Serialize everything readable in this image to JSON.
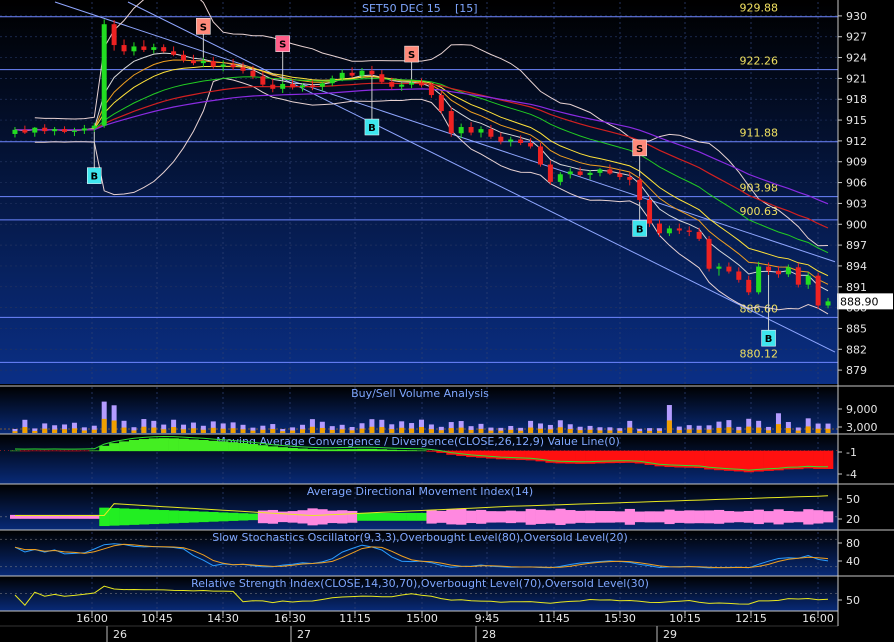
{
  "chart_data": {
    "type": "candlestick",
    "title": "SET50 DEC 15",
    "interval": "[15]",
    "last_price": "888.90",
    "price_axis": {
      "ylim": [
        877,
        932
      ],
      "ticks": [
        "930",
        "927",
        "924",
        "921",
        "918",
        "915",
        "912",
        "909",
        "906",
        "903",
        "900",
        "897",
        "894",
        "891",
        "888",
        "885",
        "882",
        "879"
      ]
    },
    "levels": [
      {
        "value": 929.88,
        "label": "929.88"
      },
      {
        "value": 922.26,
        "label": "922.26"
      },
      {
        "value": 911.88,
        "label": "911.88"
      },
      {
        "value": 903.98,
        "label": "903.98"
      },
      {
        "value": 900.63,
        "label": "900.63"
      },
      {
        "value": 886.6,
        "label": "886.60"
      },
      {
        "value": 880.12,
        "label": "880.12"
      }
    ],
    "candles": [
      [
        913,
        914,
        912.5,
        913.6
      ],
      [
        913.6,
        914.2,
        913,
        913.2
      ],
      [
        913.2,
        914,
        912.6,
        913.9
      ],
      [
        913.9,
        914.4,
        913,
        913.4
      ],
      [
        913.4,
        914,
        912.8,
        913.7
      ],
      [
        913.7,
        914.1,
        913.1,
        913.3
      ],
      [
        913.3,
        913.9,
        912.7,
        913.5
      ],
      [
        913.5,
        914.3,
        913,
        913.8
      ],
      [
        913.8,
        914.6,
        913.3,
        914.2
      ],
      [
        914.2,
        929.5,
        913.9,
        928.8
      ],
      [
        928.8,
        929.4,
        925,
        925.8
      ],
      [
        925.8,
        926.6,
        924.4,
        924.9
      ],
      [
        924.9,
        926.2,
        924.3,
        925.6
      ],
      [
        925.6,
        926.5,
        924.8,
        925.1
      ],
      [
        925.1,
        926,
        924.6,
        925.5
      ],
      [
        925.5,
        925.9,
        924.7,
        924.9
      ],
      [
        924.9,
        925.6,
        924.2,
        924.4
      ],
      [
        924.4,
        925,
        923.3,
        923.6
      ],
      [
        923.6,
        924.4,
        922.9,
        923.2
      ],
      [
        923.2,
        924,
        922.6,
        923.5
      ],
      [
        923.5,
        924.1,
        922.4,
        922.7
      ],
      [
        922.7,
        923.6,
        922,
        923
      ],
      [
        923,
        923.8,
        922.2,
        922.6
      ],
      [
        922.6,
        923.3,
        921.7,
        922.1
      ],
      [
        922.1,
        922.8,
        920.9,
        921.3
      ],
      [
        921.3,
        922,
        919.8,
        920.1
      ],
      [
        920.1,
        921,
        919,
        919.5
      ],
      [
        919.5,
        920.6,
        918.9,
        920.2
      ],
      [
        920.2,
        920.9,
        919.4,
        919.7
      ],
      [
        919.7,
        920.3,
        919.1,
        920
      ],
      [
        920,
        920.7,
        919.3,
        919.8
      ],
      [
        919.8,
        920.5,
        919.2,
        920.3
      ],
      [
        920.3,
        921.4,
        919.9,
        921
      ],
      [
        921,
        922.3,
        920.6,
        921.8
      ],
      [
        921.8,
        922.6,
        921.1,
        921.4
      ],
      [
        921.4,
        922.5,
        920.9,
        922.1
      ],
      [
        922.1,
        922.8,
        921.3,
        921.6
      ],
      [
        921.6,
        922.2,
        920.2,
        920.5
      ],
      [
        920.5,
        921.1,
        919.4,
        919.8
      ],
      [
        919.8,
        920.4,
        919.2,
        920.1
      ],
      [
        920.1,
        920.9,
        919.6,
        920.4
      ],
      [
        920.4,
        921,
        919.7,
        920
      ],
      [
        920,
        920.4,
        918.2,
        918.6
      ],
      [
        918.6,
        919.1,
        915.9,
        916.3
      ],
      [
        916.3,
        916.9,
        912.6,
        913.1
      ],
      [
        913.1,
        914.5,
        912.4,
        914
      ],
      [
        914,
        914.7,
        912.8,
        913.2
      ],
      [
        913.2,
        914.1,
        912.5,
        913.7
      ],
      [
        913.7,
        914.3,
        912.3,
        912.6
      ],
      [
        912.6,
        913.2,
        911.5,
        911.9
      ],
      [
        911.9,
        912.6,
        911.2,
        912.2
      ],
      [
        912.2,
        912.8,
        911.4,
        911.7
      ],
      [
        911.7,
        912.4,
        910.9,
        911.2
      ],
      [
        911.2,
        911.7,
        908.3,
        908.6
      ],
      [
        908.6,
        909.2,
        905.7,
        906.1
      ],
      [
        906.1,
        907.5,
        905.6,
        907.2
      ],
      [
        907.2,
        908.1,
        906.6,
        907.6
      ],
      [
        907.6,
        908.2,
        906.9,
        907.1
      ],
      [
        907.1,
        907.8,
        906.4,
        907.4
      ],
      [
        907.4,
        908.1,
        906.9,
        907.9
      ],
      [
        907.9,
        908.6,
        907.1,
        907.3
      ],
      [
        907.3,
        907.9,
        906.4,
        906.8
      ],
      [
        906.8,
        907.5,
        905.6,
        906.4
      ],
      [
        906.4,
        906.9,
        903.2,
        903.5
      ],
      [
        903.5,
        904,
        899.6,
        900.1
      ],
      [
        900.1,
        900.7,
        898.2,
        898.7
      ],
      [
        898.7,
        899.8,
        898.3,
        899.4
      ],
      [
        899.4,
        900.1,
        898.6,
        899.1
      ],
      [
        899.1,
        899.7,
        898.3,
        898.9
      ],
      [
        898.9,
        899.5,
        897.6,
        897.9
      ],
      [
        897.9,
        898.3,
        893.2,
        893.6
      ],
      [
        893.6,
        894.4,
        892.6,
        893.9
      ],
      [
        893.9,
        894.5,
        892.9,
        893.2
      ],
      [
        893.2,
        893.8,
        891.6,
        892
      ],
      [
        892,
        892.6,
        889.8,
        890.2
      ],
      [
        890.2,
        894.6,
        889.9,
        893.9
      ],
      [
        893.9,
        894.5,
        892.7,
        893.3
      ],
      [
        893.3,
        894,
        892.3,
        892.8
      ],
      [
        892.8,
        894.2,
        892.4,
        893.8
      ],
      [
        893.8,
        894.4,
        890.9,
        891.3
      ],
      [
        891.3,
        893.1,
        890.7,
        892.6
      ],
      [
        892.6,
        893,
        887.8,
        888.3
      ],
      [
        888.3,
        889.4,
        887.9,
        888.9
      ]
    ],
    "signals": [
      {
        "type": "B",
        "index": 8,
        "price": 907
      },
      {
        "type": "S",
        "index": 19,
        "price": 928.5
      },
      {
        "type": "S",
        "index": 27,
        "price": 926
      },
      {
        "type": "B",
        "index": 36,
        "price": 914
      },
      {
        "type": "S",
        "index": 40,
        "price": 924.5
      },
      {
        "type": "S",
        "index": 63,
        "price": 911
      },
      {
        "type": "B",
        "index": 63,
        "price": 899.4
      },
      {
        "type": "B",
        "index": 76,
        "price": 883.6
      }
    ],
    "time_axis": {
      "time_labels": [
        "16:00",
        "10:45",
        "14:30",
        "16:30",
        "11:15",
        "15:00",
        "9:45",
        "11:45",
        "15:30",
        "10:15",
        "12:15",
        "16:00"
      ],
      "day_labels": [
        "26",
        "27",
        "28",
        "29"
      ]
    },
    "panels": [
      {
        "title": "Buy/Sell Volume Analysis",
        "ticks": [
          "9,000",
          "3,000"
        ]
      },
      {
        "title": "Moving Average Convergence / Divergence(CLOSE,26,12,9) Value Line(0)",
        "ticks": [
          "-1",
          "-4"
        ]
      },
      {
        "title": "Average Directional Movement Index(14)",
        "ticks": [
          "50",
          "20"
        ]
      },
      {
        "title": "Slow Stochastics Oscillator(9,3,3),Overbought Level(80),Oversold Level(20)",
        "ticks": [
          "80",
          "40"
        ]
      },
      {
        "title": "Relative Strength Index(CLOSE,14,30,70),Overbought Level(70),Oversold Level(30)",
        "ticks": [
          "50"
        ]
      }
    ]
  }
}
